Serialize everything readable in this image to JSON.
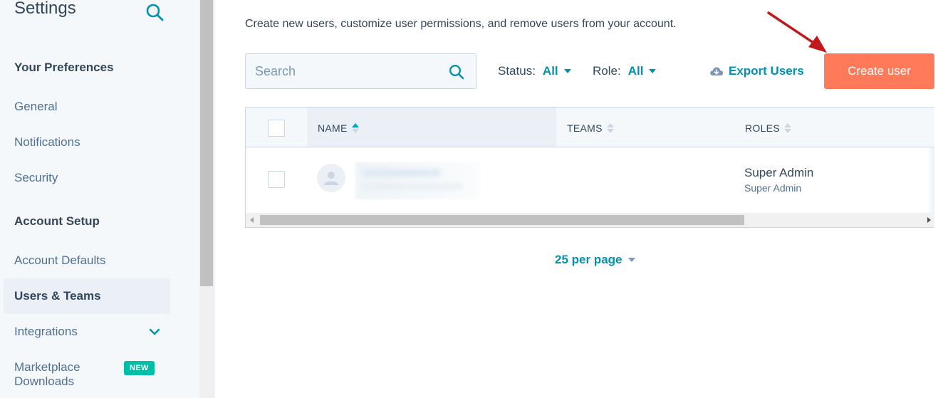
{
  "sidebar": {
    "title": "Settings",
    "sections": [
      {
        "label": "Your Preferences"
      },
      {
        "label": "Account Setup"
      }
    ],
    "items": [
      {
        "label": "General"
      },
      {
        "label": "Notifications"
      },
      {
        "label": "Security"
      },
      {
        "label": "Account Defaults"
      },
      {
        "label": "Users & Teams",
        "active": true
      },
      {
        "label": "Integrations"
      },
      {
        "label": "Marketplace Downloads",
        "line1": "Marketplace",
        "line2": "Downloads",
        "badge": "NEW"
      }
    ]
  },
  "main": {
    "intro": "Create new users, customize user permissions, and remove users from your account.",
    "search": {
      "placeholder": "Search"
    },
    "filters": {
      "status": {
        "label": "Status:",
        "value": "All"
      },
      "role": {
        "label": "Role:",
        "value": "All"
      }
    },
    "export_label": "Export Users",
    "create_label": "Create user",
    "table": {
      "columns": [
        "NAME",
        "TEAMS",
        "ROLES"
      ],
      "rows": [
        {
          "teams": "",
          "role": "Super Admin",
          "role_sub": "Super Admin"
        }
      ]
    },
    "per_page": "25 per page"
  },
  "colors": {
    "accent": "#0091ae",
    "primary_button": "#ff7a59",
    "badge": "#00bda5",
    "annotation_arrow": "#c0181b"
  }
}
